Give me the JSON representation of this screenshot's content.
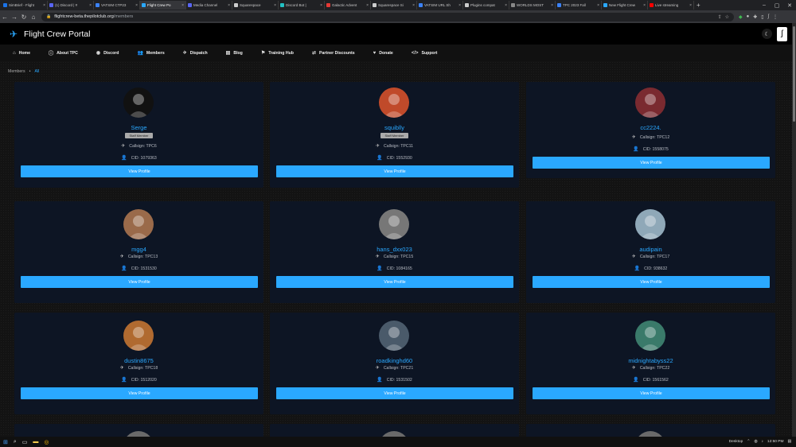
{
  "browser": {
    "tabs": [
      {
        "label": "SimBrief - Flight",
        "color": "#1a73e8"
      },
      {
        "label": "(1) Discord | #",
        "color": "#5865f2"
      },
      {
        "label": "VATSIM CTP23",
        "color": "#3b82f6"
      },
      {
        "label": "Flight Crew Po",
        "color": "#2aa8ff",
        "active": true
      },
      {
        "label": "Media Channel",
        "color": "#5865f2"
      },
      {
        "label": "Squarespace",
        "color": "#cccccc"
      },
      {
        "label": "Discord Bot |",
        "color": "#22c1c3"
      },
      {
        "label": "Galactic Advent",
        "color": "#e53935"
      },
      {
        "label": "Squarespace Si",
        "color": "#cccccc"
      },
      {
        "label": "VATSIM URL Sh",
        "color": "#3b82f6"
      },
      {
        "label": "Plugins compat",
        "color": "#cccccc"
      },
      {
        "label": "WORLDS MOST",
        "color": "#888888"
      },
      {
        "label": "TPC 2023 Fall",
        "color": "#3b82f6"
      },
      {
        "label": "New Flight Crew",
        "color": "#2aa8ff"
      },
      {
        "label": "Live streaming",
        "color": "#ff0000"
      }
    ],
    "url_host": "flightcrew-beta.thepilotclub.org",
    "url_path": "/members"
  },
  "site": {
    "title": "Flight Crew Portal",
    "nav": [
      {
        "label": "Home",
        "icon": "home-icon",
        "glyph": "⌂"
      },
      {
        "label": "About TPC",
        "icon": "info-icon",
        "glyph": "ⓘ"
      },
      {
        "label": "Discord",
        "icon": "discord-icon",
        "glyph": "◉"
      },
      {
        "label": "Members",
        "icon": "users-icon",
        "glyph": "👥"
      },
      {
        "label": "Dispatch",
        "icon": "plane-icon",
        "glyph": "✈"
      },
      {
        "label": "Blog",
        "icon": "blog-icon",
        "glyph": "▤"
      },
      {
        "label": "Training Hub",
        "icon": "training-icon",
        "glyph": "⚑"
      },
      {
        "label": "Partner Discounts",
        "icon": "handshake-icon",
        "glyph": "⇄"
      },
      {
        "label": "Donate",
        "icon": "donate-icon",
        "glyph": "♥"
      },
      {
        "label": "Support",
        "icon": "code-icon",
        "glyph": "</>"
      }
    ]
  },
  "breadcrumb": {
    "root": "Members",
    "sep": "•",
    "current": "All"
  },
  "members": [
    {
      "name": "Serge",
      "badge": "Staff Member",
      "callsign": "Callsign: TPC6",
      "cid": "CID: 1079363",
      "button": "View Profile",
      "avatar_bg": "#111111"
    },
    {
      "name": "squiblly",
      "badge": "Staff Member",
      "callsign": "Callsign: TPC11",
      "cid": "CID: 1552930",
      "button": "View Profile",
      "avatar_bg": "#c04a2a"
    },
    {
      "name": "cc2224.",
      "badge": "",
      "callsign": "Callsign: TPC12",
      "cid": "CID: 1558075",
      "button": "View Profile",
      "avatar_bg": "#7a2a30"
    },
    {
      "name": "mgg4",
      "badge": "",
      "callsign": "Callsign: TPC13",
      "cid": "CID: 1531530",
      "button": "View Profile",
      "avatar_bg": "#9a6a4a"
    },
    {
      "name": "hans_dxx023",
      "badge": "",
      "callsign": "Callsign: TPC15",
      "cid": "CID: 1084165",
      "button": "View Profile",
      "avatar_bg": "#777777"
    },
    {
      "name": "audipain",
      "badge": "",
      "callsign": "Callsign: TPC17",
      "cid": "CID: 938632",
      "button": "View Profile",
      "avatar_bg": "#8fa8b8"
    },
    {
      "name": "dustin8675",
      "badge": "",
      "callsign": "Callsign: TPC18",
      "cid": "CID: 1512020",
      "button": "View Profile",
      "avatar_bg": "#b06a30"
    },
    {
      "name": "roadkinghd60",
      "badge": "",
      "callsign": "Callsign: TPC21",
      "cid": "CID: 1531502",
      "button": "View Profile",
      "avatar_bg": "#4a5a6a"
    },
    {
      "name": "midnightabyss22",
      "badge": "",
      "callsign": "Callsign: TPC22",
      "cid": "CID: 1561562",
      "button": "View Profile",
      "avatar_bg": "#3a7a6a"
    }
  ],
  "taskbar": {
    "desktop_label": "Desktop",
    "time": "12:50 PM"
  }
}
